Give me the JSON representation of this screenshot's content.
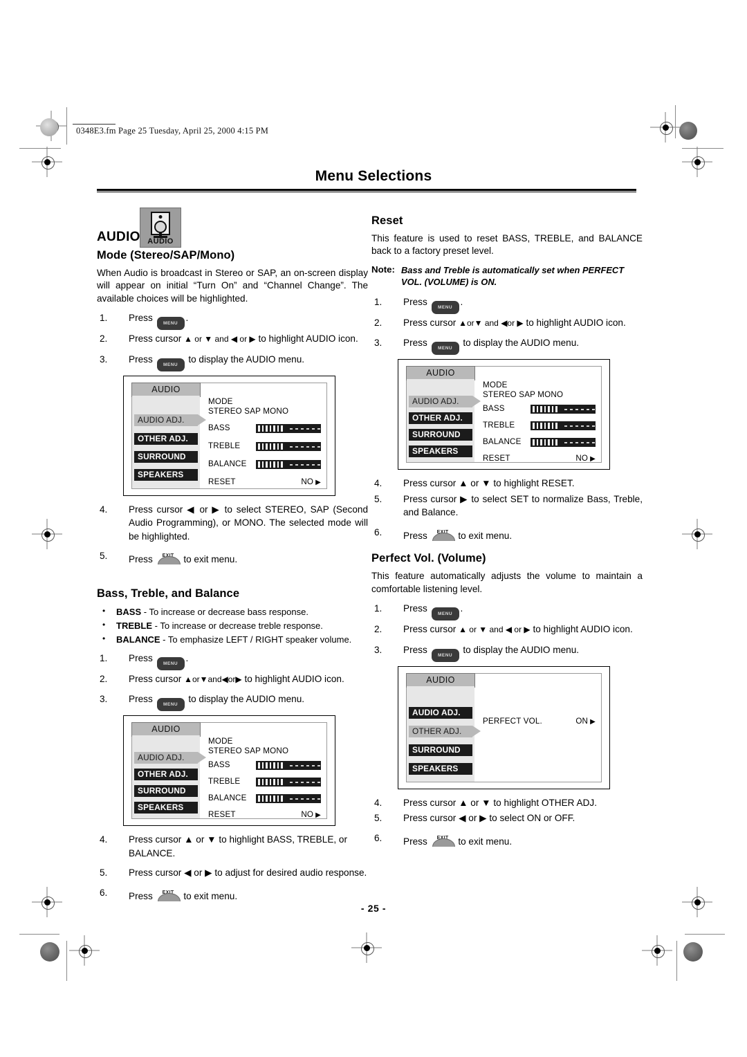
{
  "header": {
    "file_info": "0348E3.fm  Page 25  Tuesday, April 25, 2000  4:15 PM"
  },
  "title": "Menu Selections",
  "page_number": "- 25 -",
  "brand": {
    "label": "AUDIO",
    "badge_label": "AUDIO"
  },
  "left_column": {
    "mode_section": {
      "heading": "Mode (Stereo/SAP/Mono)",
      "paragraph": "When Audio is broadcast in Stereo or SAP, an on-screen display will appear on initial “Turn On” and “Channel Change”. The available choices will be highlighted.",
      "steps": [
        {
          "num": "1.",
          "text_pre": "Press",
          "key": "MENU",
          "text_post": "."
        },
        {
          "num": "2.",
          "text_pre": "Press cursor",
          "arrows": "▲ or ▼ and ◀ or ▶",
          "text_post": "to highlight AUDIO icon."
        },
        {
          "num": "3.",
          "text_pre": "Press",
          "key": "MENU",
          "text_post": "to display the AUDIO menu."
        }
      ],
      "steps_after": [
        {
          "num": "4.",
          "text": "Press cursor ◀ or ▶ to select STEREO, SAP (Second Audio Programming), or MONO. The selected mode will be highlighted."
        },
        {
          "num": "5.",
          "text_pre": "Press",
          "key": "EXIT",
          "text_post": "to exit menu."
        }
      ]
    },
    "btb_section": {
      "heading": "Bass, Treble, and Balance",
      "bullets": [
        {
          "term": "BASS",
          "desc": " - To increase or decrease bass response."
        },
        {
          "term": "TREBLE",
          "desc": " - To increase or decrease treble response."
        },
        {
          "term": "BALANCE",
          "desc": " - To emphasize LEFT / RIGHT speaker volume."
        }
      ],
      "steps": [
        {
          "num": "1.",
          "text_pre": "Press",
          "key": "MENU",
          "text_post": "."
        },
        {
          "num": "2.",
          "text_pre": "Press cursor",
          "arrows": "▲or▼and◀or▶",
          "text_post": "to highlight AUDIO icon."
        },
        {
          "num": "3.",
          "text_pre": "Press",
          "key": "MENU",
          "text_post": "to display the AUDIO menu."
        }
      ],
      "steps_after": [
        {
          "num": "4.",
          "text": "Press cursor ▲ or ▼ to highlight BASS, TREBLE, or BALANCE."
        },
        {
          "num": "5.",
          "text": "Press cursor ◀ or ▶ to adjust for desired audio response."
        },
        {
          "num": "6.",
          "text_pre": "Press",
          "key": "EXIT",
          "text_post": "to exit menu."
        }
      ]
    }
  },
  "right_column": {
    "reset_section": {
      "heading": "Reset",
      "paragraph": "This feature is used to reset BASS, TREBLE, and BALANCE back to a factory preset level.",
      "note_label": "Note:",
      "note_text": "Bass and Treble is automatically set when PERFECT VOL. (VOLUME) is ON.",
      "steps": [
        {
          "num": "1.",
          "text_pre": "Press",
          "key": "MENU",
          "text_post": "."
        },
        {
          "num": "2.",
          "text_pre": "Press cursor",
          "arrows": "▲or▼ and ◀or ▶",
          "text_post": "to highlight AUDIO icon."
        },
        {
          "num": "3.",
          "text_pre": "Press",
          "key": "MENU",
          "text_post": "to display the AUDIO menu."
        }
      ],
      "steps_after": [
        {
          "num": "4.",
          "text": "Press cursor ▲ or ▼ to highlight RESET."
        },
        {
          "num": "5.",
          "text": "Press cursor ▶ to select SET to normalize Bass, Treble, and Balance."
        },
        {
          "num": "6.",
          "text_pre": "Press",
          "key": "EXIT",
          "text_post": "to exit menu."
        }
      ]
    },
    "perfect_vol_section": {
      "heading": "Perfect Vol. (Volume)",
      "paragraph": "This feature automatically adjusts the volume to maintain a comfortable listening level.",
      "steps": [
        {
          "num": "1.",
          "text_pre": "Press",
          "key": "MENU",
          "text_post": "."
        },
        {
          "num": "2.",
          "text_pre": "Press cursor",
          "arrows": "▲ or ▼ and ◀ or ▶",
          "text_post": "to highlight AUDIO icon."
        },
        {
          "num": "3.",
          "text_pre": "Press",
          "key": "MENU",
          "text_post": "to display the AUDIO menu."
        }
      ],
      "steps_after": [
        {
          "num": "4.",
          "text": "Press cursor ▲ or ▼ to highlight OTHER ADJ."
        },
        {
          "num": "5.",
          "text": "Press cursor ◀ or ▶ to select ON or OFF."
        },
        {
          "num": "6.",
          "text_pre": "Press",
          "key": "EXIT",
          "text_post": "to exit menu."
        }
      ]
    }
  },
  "osd_audio_adj": {
    "tab": "AUDIO",
    "menu_items": [
      {
        "label": "AUDIO ADJ.",
        "state": "selected"
      },
      {
        "label": "OTHER ADJ.",
        "state": "dark"
      },
      {
        "label": "SURROUND",
        "state": "dark"
      },
      {
        "label": "SPEAKERS",
        "state": "dark"
      }
    ],
    "mode_line1": "MODE",
    "mode_line2": "STEREO SAP MONO",
    "rows": [
      {
        "label": "BASS",
        "type": "bar",
        "filled": 7,
        "dashes": 8
      },
      {
        "label": "TREBLE",
        "type": "bar",
        "filled": 7,
        "dashes": 8
      },
      {
        "label": "BALANCE",
        "type": "bar",
        "filled": 7,
        "dashes": 8
      },
      {
        "label": "RESET",
        "type": "value",
        "value": "NO"
      }
    ]
  },
  "osd_perfect_vol": {
    "tab": "AUDIO",
    "menu_items": [
      {
        "label": "AUDIO ADJ.",
        "state": "dark"
      },
      {
        "label": "OTHER ADJ.",
        "state": "selected"
      },
      {
        "label": "SURROUND",
        "state": "dark"
      },
      {
        "label": "SPEAKERS",
        "state": "dark"
      }
    ],
    "rows": [
      {
        "label": "PERFECT VOL.",
        "type": "value",
        "value": "ON"
      }
    ]
  }
}
